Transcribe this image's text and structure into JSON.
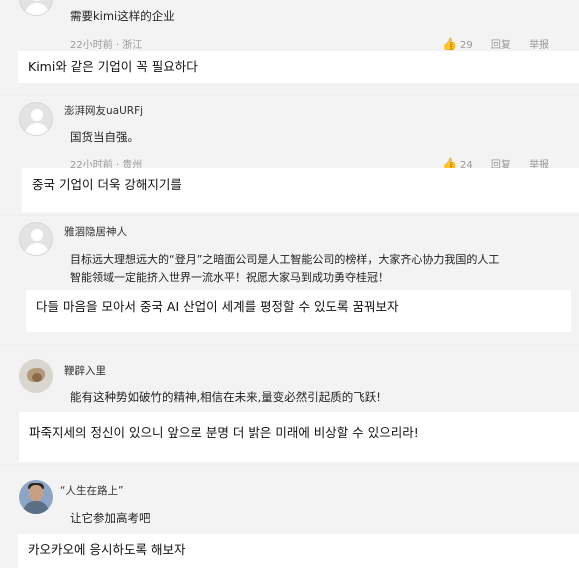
{
  "comments": [
    {
      "username": "",
      "text": "需要kimi这样的企业",
      "time": "22小时前",
      "location": "浙江",
      "likes": "29",
      "reply_label": "回复",
      "report_label": "举报",
      "translation": "Kimi와 같은 기업이 꼭 필요하다"
    },
    {
      "username": "澎湃网友uaURFj",
      "text": "国货当自强。",
      "time": "22小时前",
      "location": "贵州",
      "likes": "24",
      "reply_label": "回复",
      "report_label": "举报",
      "translation": "중국 기업이 더욱 강해지기를"
    },
    {
      "username": "雅涸隐居神人",
      "text_line1": "目标远大理想远大的“登月”之暗面公司是人工智能公司的榜样，大家齐心协力我国的人工",
      "text_line2": "智能领域一定能挤入世界一流水平！祝愿大家马到成功勇夺桂冠！",
      "translation": "다들 마음을 모아서 중국 AI 산업이 세계를 평정할 수 있도록 꿈꿔보자"
    },
    {
      "username": "鞭辟入里",
      "text": "能有这种势如破竹的精神,相信在未来,量变必然引起质的飞跃!",
      "translation": "파죽지세의 정신이 있으니 앞으로 분명 더 밝은 미래에 비상할 수 있으리라!"
    },
    {
      "username": "“人生在路上”",
      "text": "让它参加高考吧",
      "translation": "카오카오에 응시하도록 해보자"
    }
  ],
  "meta_separator": "·",
  "icons": {
    "like": "thumbs-up-icon"
  }
}
